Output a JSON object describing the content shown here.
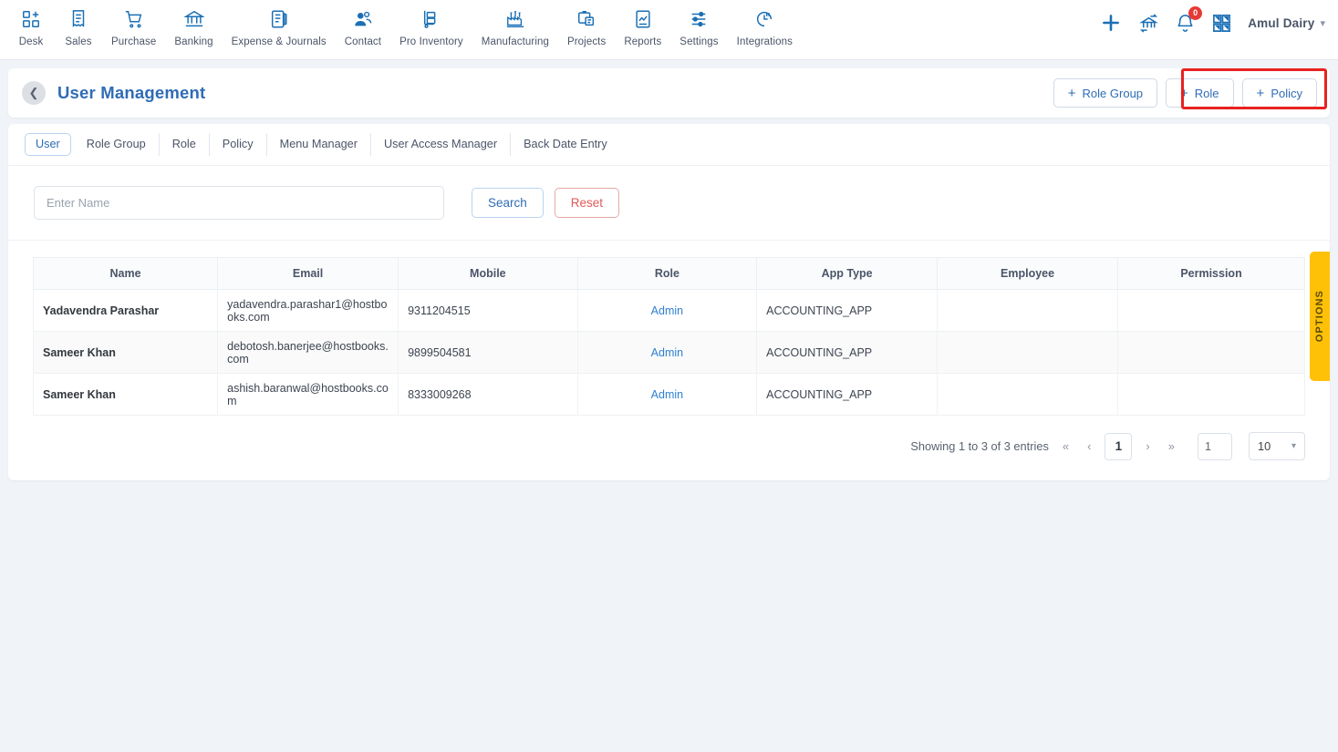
{
  "topnav": {
    "items": [
      {
        "label": "Desk",
        "icon": "desk-icon"
      },
      {
        "label": "Sales",
        "icon": "sales-icon"
      },
      {
        "label": "Purchase",
        "icon": "purchase-cart-icon"
      },
      {
        "label": "Banking",
        "icon": "bank-icon"
      },
      {
        "label": "Expense & Journals",
        "icon": "journal-icon"
      },
      {
        "label": "Contact",
        "icon": "contacts-icon"
      },
      {
        "label": "Pro Inventory",
        "icon": "inventory-trolley-icon"
      },
      {
        "label": "Manufacturing",
        "icon": "manufacturing-icon"
      },
      {
        "label": "Projects",
        "icon": "projects-clipboard-icon"
      },
      {
        "label": "Reports",
        "icon": "reports-chart-icon"
      },
      {
        "label": "Settings",
        "icon": "settings-sliders-icon"
      },
      {
        "label": "Integrations",
        "icon": "integrations-plug-icon"
      }
    ],
    "right": {
      "add_icon": "plus-icon",
      "transfer_icon": "bank-transfer-icon",
      "bell_icon": "notification-bell-icon",
      "notification_count": "0",
      "apps_icon": "apps-grid-icon",
      "org_name": "Amul Dairy",
      "caret_icon": "chevron-down-icon"
    }
  },
  "page_header": {
    "back_icon": "back-chevron-icon",
    "title": "User Management",
    "buttons": [
      {
        "label": "Role Group",
        "icon": "plus-icon"
      },
      {
        "label": "Role",
        "icon": "plus-icon"
      },
      {
        "label": "Policy",
        "icon": "plus-icon"
      }
    ],
    "highlight_color": "#e8221f"
  },
  "tabs": [
    {
      "label": "User",
      "active": true
    },
    {
      "label": "Role Group",
      "active": false
    },
    {
      "label": "Role",
      "active": false
    },
    {
      "label": "Policy",
      "active": false
    },
    {
      "label": "Menu Manager",
      "active": false
    },
    {
      "label": "User Access Manager",
      "active": false
    },
    {
      "label": "Back Date Entry",
      "active": false
    }
  ],
  "search": {
    "placeholder": "Enter Name",
    "value": "",
    "search_label": "Search",
    "reset_label": "Reset"
  },
  "table": {
    "headers": [
      "Name",
      "Email",
      "Mobile",
      "Role",
      "App Type",
      "Employee",
      "Permission"
    ],
    "rows": [
      {
        "name": "Yadavendra Parashar",
        "email": "yadavendra.parashar1@hostbooks.com",
        "mobile": "9311204515",
        "role": "Admin",
        "app_type": "ACCOUNTING_APP",
        "employee": "",
        "permission": ""
      },
      {
        "name": "Sameer Khan",
        "email": "debotosh.banerjee@hostbooks.com",
        "mobile": "9899504581",
        "role": "Admin",
        "app_type": "ACCOUNTING_APP",
        "employee": "",
        "permission": ""
      },
      {
        "name": "Sameer Khan",
        "email": "ashish.baranwal@hostbooks.com",
        "mobile": "8333009268",
        "role": "Admin",
        "app_type": "ACCOUNTING_APP",
        "employee": "",
        "permission": ""
      }
    ]
  },
  "pagination": {
    "summary": "Showing 1 to 3 of 3 entries",
    "first_icon": "double-chevron-left-icon",
    "prev_icon": "chevron-left-icon",
    "current_page": "1",
    "next_icon": "chevron-right-icon",
    "last_icon": "double-chevron-right-icon",
    "jump_value": "1",
    "page_size": "10",
    "page_size_caret": "chevron-down-icon"
  },
  "options_tab": {
    "label": "OPTIONS",
    "color": "#ffc107"
  },
  "theme": {
    "accent_blue": "#2f6cb5",
    "link_blue": "#2f7fd1",
    "danger_red": "#e05a5a",
    "page_bg": "#f0f3f7"
  }
}
